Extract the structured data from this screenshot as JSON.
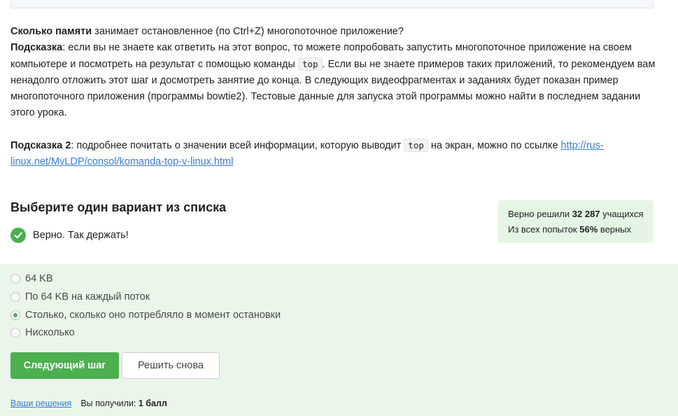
{
  "question": {
    "line1_bold": "Сколько памяти",
    "line1_rest": " занимает остановленное (по Ctrl+Z) многопоточное приложение?",
    "hint1_label": "Подсказка",
    "hint1_pre": ": если вы не знаете как ответить на этот вопрос, то можете попробовать запустить многопоточное приложение на своем компьютере и посмотреть на результат с помощью команды ",
    "hint1_code": "top",
    "hint1_post": ". Если вы не знаете примеров таких приложений, то рекомендуем вам ненадолго отложить этот шаг и досмотреть занятие до конца. В следующих видеофрагментах и заданиях будет показан пример многопоточного приложения (программы bowtie2). Тестовые данные для запуска этой программы можно найти в последнем задании этого урока.",
    "hint2_label": "Подсказка 2",
    "hint2_pre": ": подробнее почитать о значении всей информации, которую выводит ",
    "hint2_code": "top",
    "hint2_mid": " на экран, можно по ссылке ",
    "hint2_link": "http://rus-linux.net/MyLDP/consol/komanda-top-v-linux.html"
  },
  "select_title": "Выберите один вариант из списка",
  "status_text": "Верно. Так держать!",
  "stats": {
    "solved_prefix": "Верно решили ",
    "solved_count": "32 287",
    "solved_suffix": " учащихся",
    "attempts_prefix": "Из всех попыток ",
    "attempts_percent": "56%",
    "attempts_suffix": " верных"
  },
  "options": [
    {
      "label": "64 KB",
      "checked": false
    },
    {
      "label": "По 64 KB на каждый поток",
      "checked": false
    },
    {
      "label": "Столько, сколько оно потребляло в момент остановки",
      "checked": true
    },
    {
      "label": "Нисколько",
      "checked": false
    }
  ],
  "buttons": {
    "next": "Следующий шаг",
    "retry": "Решить снова"
  },
  "footer": {
    "solutions_link": "Ваши решения",
    "score_prefix": "Вы получили: ",
    "score_value": "1 балл"
  },
  "colors": {
    "accent_green": "#4caf50",
    "panel_green": "#e9f6e9",
    "link_blue": "#3a7bd5"
  },
  "icons": {
    "status": "check-circle-icon",
    "option_selected": "radio-checked-icon"
  }
}
